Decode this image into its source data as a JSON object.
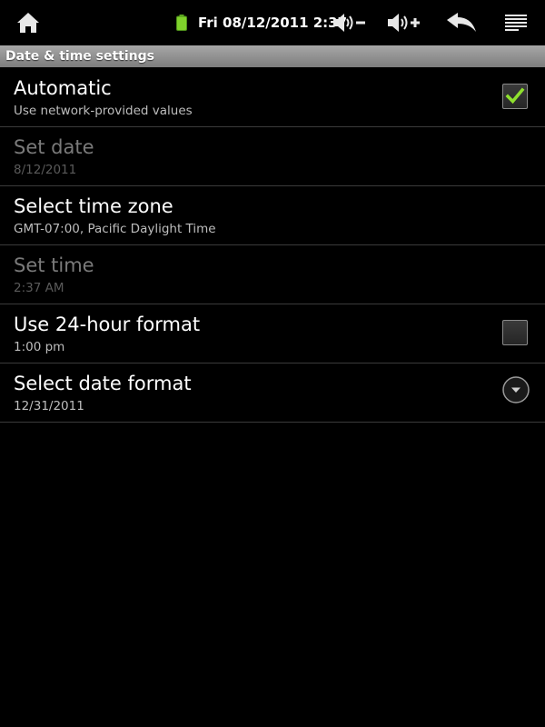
{
  "status_bar": {
    "clock": "Fri 08/12/2011 2:37",
    "battery_color": "#7fd12b",
    "icons": [
      "home-icon",
      "battery-icon",
      "volume-down-icon",
      "volume-up-icon",
      "back-icon",
      "menu-icon"
    ]
  },
  "screen": {
    "title": "Date & time settings"
  },
  "settings": [
    {
      "title": "Automatic",
      "summary": "Use network-provided values",
      "enabled": true,
      "widget": "checkbox",
      "checked": true
    },
    {
      "title": "Set date",
      "summary": "8/12/2011",
      "enabled": false,
      "widget": "none"
    },
    {
      "title": "Select time zone",
      "summary": "GMT-07:00, Pacific Daylight Time",
      "enabled": true,
      "widget": "none"
    },
    {
      "title": "Set time",
      "summary": "2:37 AM",
      "enabled": false,
      "widget": "none"
    },
    {
      "title": "Use 24-hour format",
      "summary": "1:00 pm",
      "enabled": true,
      "widget": "checkbox",
      "checked": false
    },
    {
      "title": "Select date format",
      "summary": "12/31/2011",
      "enabled": true,
      "widget": "dropdown"
    }
  ],
  "colors": {
    "check_mark": "#8fe02e",
    "divider": "#3b3b3b"
  }
}
